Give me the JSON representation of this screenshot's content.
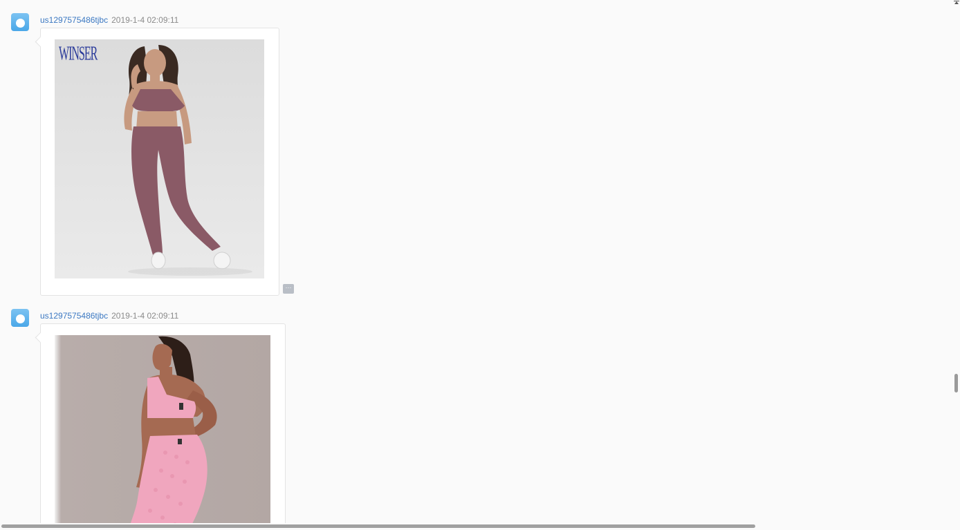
{
  "messages": [
    {
      "username": "us1297575486tjbc",
      "timestamp": "2019-1-4 02:09:11",
      "image": {
        "description_icon": "photo-icon",
        "watermark": "WINSER",
        "outfit_color": "#8a5a66",
        "background_color": "#d9d9d9"
      },
      "more_label": "···"
    },
    {
      "username": "us1297575486tjbc",
      "timestamp": "2019-1-4 02:09:11",
      "image": {
        "description_icon": "photo-icon",
        "outfit_color": "#f0a6be",
        "background_color": "#b6aaa7"
      }
    }
  ],
  "colors": {
    "link": "#3b78c2",
    "muted": "#8a8a8a",
    "avatar": "#5aaee9"
  }
}
